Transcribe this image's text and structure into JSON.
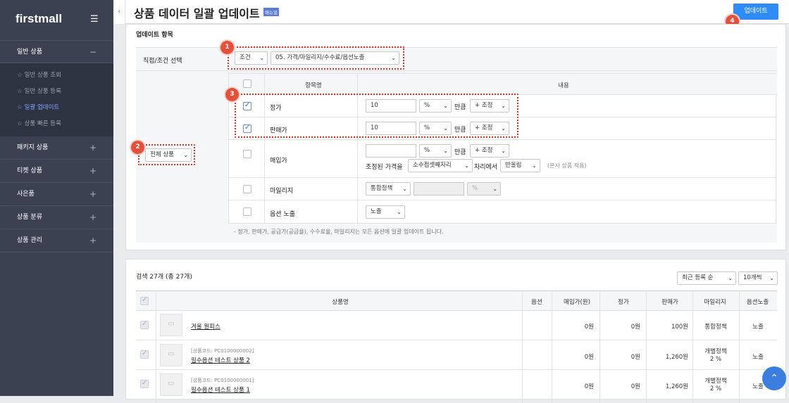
{
  "sidebar": {
    "logo": "firstmall",
    "sections": [
      {
        "label": "일반 상품",
        "toggle": "−",
        "items": [
          {
            "label": "일반 상품 조회"
          },
          {
            "label": "일반 상품 등록"
          },
          {
            "label": "일괄 업데이트",
            "active": true
          },
          {
            "label": "상품 빠른 등록"
          }
        ]
      },
      {
        "label": "패키지 상품",
        "toggle": "+"
      },
      {
        "label": "티켓 상품",
        "toggle": "+"
      },
      {
        "label": "사은품",
        "toggle": "+"
      },
      {
        "label": "상품 분류",
        "toggle": "+"
      },
      {
        "label": "상품 관리",
        "toggle": "+"
      }
    ]
  },
  "header": {
    "title": "상품 데이터 일괄 업데이트",
    "manual_badge": "매뉴얼",
    "update_button": "업데이트"
  },
  "badges": [
    "1",
    "2",
    "3",
    "4"
  ],
  "update_section": {
    "title": "업데이트 항목",
    "select_label": "직접/조건 선택",
    "mode_select": "조건",
    "field_select": "05. 가격/마일리지/수수료/옵션노출",
    "target_select": "전체 상품",
    "grid_headers": {
      "item": "항목명",
      "content": "내용"
    },
    "rows": [
      {
        "name": "정가",
        "checked": true,
        "value": "10",
        "unit": "%",
        "mid": "만큼",
        "op": "+ 조정"
      },
      {
        "name": "판매가",
        "checked": true,
        "value": "10",
        "unit": "%",
        "mid": "만큼",
        "op": "+ 조정"
      },
      {
        "name": "매입가",
        "checked": false,
        "value": "",
        "unit": "%",
        "mid": "만큼",
        "op": "+ 조정",
        "adjust_label": "조정된 가격을",
        "digit": "소수점셋째자리",
        "place_text": "자리에서",
        "round": "반올림",
        "note": "(본사 상품 적용)"
      },
      {
        "name": "마일리지",
        "checked": false,
        "policy": "통합정책",
        "unit": "%"
      },
      {
        "name": "옵션 노출",
        "checked": false,
        "expose": "노출"
      }
    ],
    "footnote": "- 정가, 판매가, 공급가(공급율), 수수료율, 마일리지는 모든 옵션에 일괄 업데이트 됩니다."
  },
  "result_section": {
    "count_text": "검색 27개 (총 27개)",
    "sort_select": "최근 등록 순",
    "per_page_select": "10개씩",
    "columns": [
      "상품명",
      "옵션",
      "매입가(원)",
      "정가",
      "판매가",
      "마일리지",
      "옵션노출"
    ],
    "products": [
      {
        "code": "",
        "name": "겨울 원피스",
        "option": "",
        "cost": "0원",
        "price": "0원",
        "sale": "100원",
        "mileage": "통합정책",
        "mileage2": "",
        "expose": "노출"
      },
      {
        "code": "[상품코드: PC0100000002]",
        "name": "필수옵션 테스트 상품 2",
        "option": "",
        "cost": "0원",
        "price": "0원",
        "sale": "1,260원",
        "mileage": "개별정책",
        "mileage2": "2 %",
        "expose": "노출"
      },
      {
        "code": "[상품코드: PC0100000001]",
        "name": "필수옵션 테스트 상품 1",
        "option": "",
        "cost": "0원",
        "price": "0원",
        "sale": "1,260원",
        "mileage": "개별정책",
        "mileage2": "2 %",
        "expose": "노출"
      }
    ]
  },
  "icons": {
    "menu": "hamburger-icon",
    "collapse": "chevron-left-icon",
    "scroll_top": "chevron-up-icon"
  }
}
